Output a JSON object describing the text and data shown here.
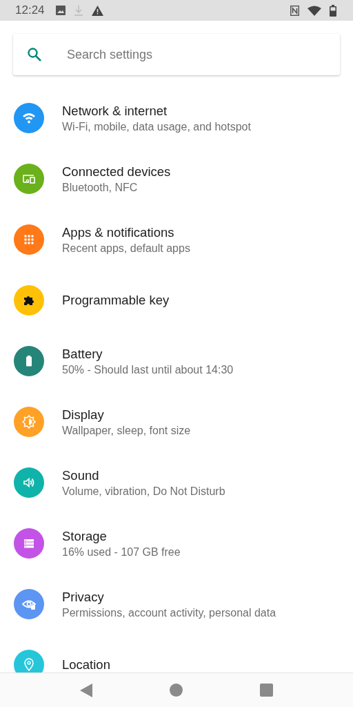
{
  "status_bar": {
    "time": "12:24"
  },
  "search": {
    "placeholder": "Search settings"
  },
  "items": [
    {
      "kind": "wifi",
      "color": "#2196f3",
      "title": "Network & internet",
      "subtitle": "Wi-Fi, mobile, data usage, and hotspot"
    },
    {
      "kind": "devices",
      "color": "#6ab11c",
      "title": "Connected devices",
      "subtitle": "Bluetooth, NFC"
    },
    {
      "kind": "apps",
      "color": "#ff7918",
      "title": "Apps & notifications",
      "subtitle": "Recent apps, default apps"
    },
    {
      "kind": "puzzle",
      "color": "#ffc107",
      "title": "Programmable key"
    },
    {
      "kind": "battery",
      "color": "#268579",
      "title": "Battery",
      "subtitle": "50% - Should last until about 14:30"
    },
    {
      "kind": "display",
      "color": "#ffa126",
      "title": "Display",
      "subtitle": "Wallpaper, sleep, font size"
    },
    {
      "kind": "sound",
      "color": "#10b3a9",
      "title": "Sound",
      "subtitle": "Volume, vibration, Do Not Disturb"
    },
    {
      "kind": "storage",
      "color": "#c353e6",
      "title": "Storage",
      "subtitle": "16% used - 107 GB free"
    },
    {
      "kind": "privacy",
      "color": "#5c95f2",
      "title": "Privacy",
      "subtitle": "Permissions, account activity, personal data"
    },
    {
      "kind": "location",
      "color": "#26c6da",
      "title": "Location"
    }
  ]
}
